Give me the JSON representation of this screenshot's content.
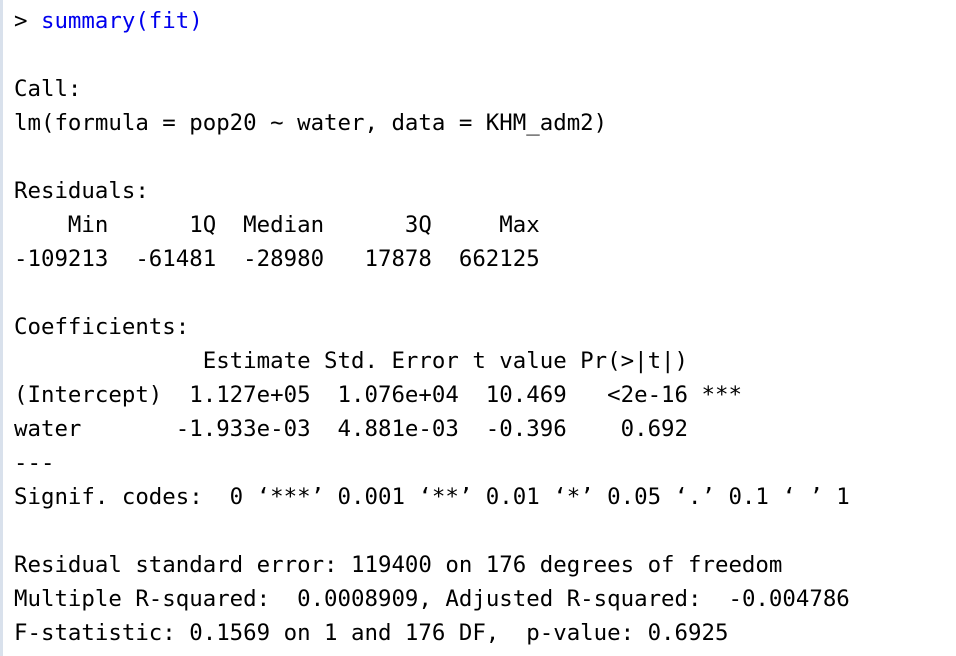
{
  "prompt": {
    "symbol": "> ",
    "command": "summary(fit)"
  },
  "output": {
    "call_header": "Call:",
    "call_formula": "lm(formula = pop20 ~ water, data = KHM_adm2)",
    "residuals_header": "Residuals:",
    "residuals_labels": "    Min      1Q  Median      3Q     Max ",
    "residuals_values": "-109213  -61481  -28980   17878  662125 ",
    "coefficients_header": "Coefficients:",
    "coef_table_header": "              Estimate Std. Error t value Pr(>|t|)    ",
    "coef_intercept_row": "(Intercept)  1.127e+05  1.076e+04  10.469   <2e-16 ***",
    "coef_water_row": "water       -1.933e-03  4.881e-03  -0.396    0.692    ",
    "separator": "---",
    "signif_codes": "Signif. codes:  0 ‘***’ 0.001 ‘**’ 0.01 ‘*’ 0.05 ‘.’ 0.1 ‘ ’ 1",
    "residual_se": "Residual standard error: 119400 on 176 degrees of freedom",
    "r_squared": "Multiple R-squared:  0.0008909,\tAdjusted R-squared:  -0.004786 ",
    "f_statistic": "F-statistic: 0.1569 on 1 and 176 DF,  p-value: 0.6925"
  },
  "colors": {
    "command": "#0000ee",
    "output": "#000000",
    "gutter": "#d9e1ec"
  }
}
